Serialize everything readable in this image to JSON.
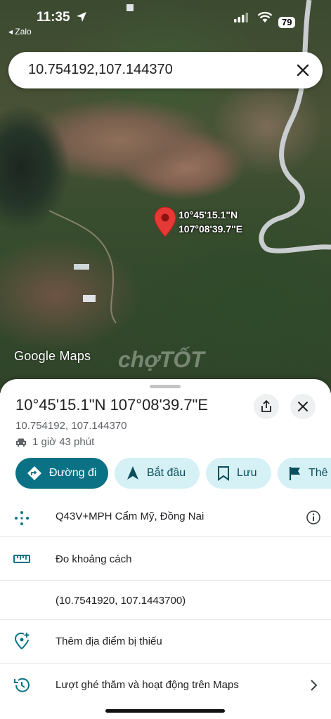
{
  "status_bar": {
    "time": "11:35",
    "back_app": "◂ Zalo",
    "battery": "79"
  },
  "search": {
    "value": "10.754192,107.144370"
  },
  "map": {
    "pin_label_lat": "10°45'15.1\"N",
    "pin_label_lng": "107°08'39.7\"E",
    "attribution": "Google Maps",
    "watermark": "chợTỐT"
  },
  "sheet": {
    "title": "10°45'15.1\"N 107°08'39.7\"E",
    "decimal_coords": "10.754192, 107.144370",
    "drive_time": "1 giờ 43 phút",
    "chips": [
      {
        "label": "Đường đi",
        "icon": "directions-icon"
      },
      {
        "label": "Bắt đầu",
        "icon": "navigation-icon"
      },
      {
        "label": "Lưu",
        "icon": "bookmark-icon"
      },
      {
        "label": "Thê",
        "icon": "flag-icon"
      }
    ],
    "rows": [
      {
        "label": "Q43V+MPH Cẩm Mỹ, Đồng Nai",
        "icon": "plus-code-icon"
      },
      {
        "label": "Đo khoảng cách",
        "icon": "ruler-icon"
      },
      {
        "label": "(10.7541920, 107.1443700)",
        "icon": ""
      },
      {
        "label": "Thêm địa điểm bị thiếu",
        "icon": "add-location-icon"
      },
      {
        "label": "Lượt ghé thăm và hoạt động trên Maps",
        "icon": "history-icon"
      }
    ]
  },
  "colors": {
    "primary": "#0b7285",
    "chip_secondary": "#d5f1f6",
    "pin": "#e53935"
  }
}
